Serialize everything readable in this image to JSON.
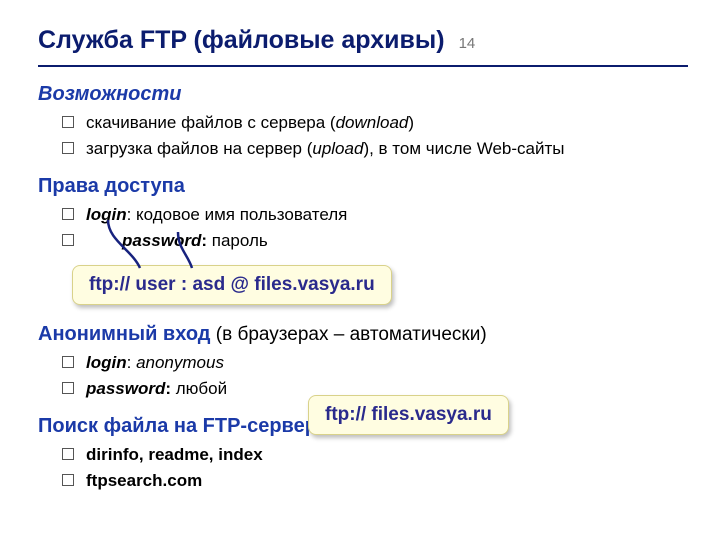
{
  "slide": {
    "title": "Служба FTP (файловые архивы)",
    "number": "14"
  },
  "sections": {
    "s1": {
      "heading": "Возможности",
      "items": [
        {
          "pre": "скачивание файлов c сервера (",
          "ital": "download",
          "post": ")"
        },
        {
          "pre": "загрузка файлов на сервер (",
          "ital": "upload",
          "post": "), в том числе Web-сайты"
        }
      ]
    },
    "s2": {
      "heading": "Права доступа",
      "items": [
        {
          "bold_ital": "login",
          "post": ": кодовое имя пользователя"
        },
        {
          "indent": true,
          "bold_ital": "password",
          "bold": ":",
          "post": " пароль"
        }
      ]
    },
    "s3": {
      "heading": "Анонимный вход",
      "heading_tail": " (в браузерах – автоматически)",
      "items": [
        {
          "bold_ital": "login",
          "post": ": ",
          "ital": "anonymous"
        },
        {
          "bold_ital": "password",
          "bold": ":",
          "post": " любой"
        }
      ]
    },
    "s4": {
      "heading": "Поиск файла на FTP-сервере",
      "items": [
        {
          "bold": "dirinfo, readme, index"
        },
        {
          "bold": "ftpsearch.com"
        }
      ]
    }
  },
  "callouts": {
    "c1": "ftp:// user : asd @ files.vasya.ru",
    "c2": "ftp:// files.vasya.ru"
  }
}
